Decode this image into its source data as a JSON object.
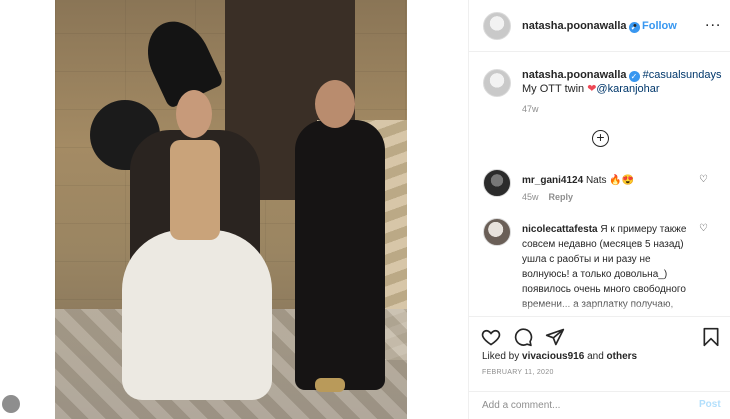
{
  "post": {
    "image_alt": "Two people in ornate costumes posing in front of a stone stairway",
    "header": {
      "username": "natasha.poonawalla",
      "follow_separator": "•",
      "follow_label": "Follow",
      "more_label": "..."
    },
    "caption": {
      "username": "natasha.poonawalla",
      "hashtag": "#casualsundays",
      "text_prefix": "My OTT twin",
      "mention": "@karanjohar",
      "age": "47w"
    },
    "load_more_label": "+",
    "comments": [
      {
        "username": "mr_gani4124",
        "text": "Nats",
        "emoji": "🔥😍",
        "age": "45w",
        "reply_label": "Reply"
      },
      {
        "username": "nicolecattafesta",
        "text": "Я к примеру также совсем недавно (месяцев 5 назад) ушла с раобты и ни разу не волнуюсь! а только довольна_) появилось очень много свободного времени... а зарплатку получаю, отвечая на опросы от крупных"
      }
    ],
    "actions": {
      "liked_prefix": "Liked by",
      "liked_user": "vivacious916",
      "liked_and": "and",
      "liked_others": "others",
      "date": "FEBRUARY 11, 2020"
    },
    "comment_box": {
      "placeholder": "Add a comment...",
      "post_label": "Post"
    }
  },
  "colors": {
    "link_blue": "#3897f0",
    "verified_blue": "#3897f0",
    "heart_red": "#ed4956",
    "muted_text": "#8e8e8e",
    "post_button_disabled": "#b2dffc"
  },
  "icons": [
    "verified-badge-icon",
    "heart-icon",
    "comment-icon",
    "share-icon",
    "bookmark-icon",
    "plus-circle-icon",
    "small-heart-icon",
    "more-options-icon"
  ]
}
